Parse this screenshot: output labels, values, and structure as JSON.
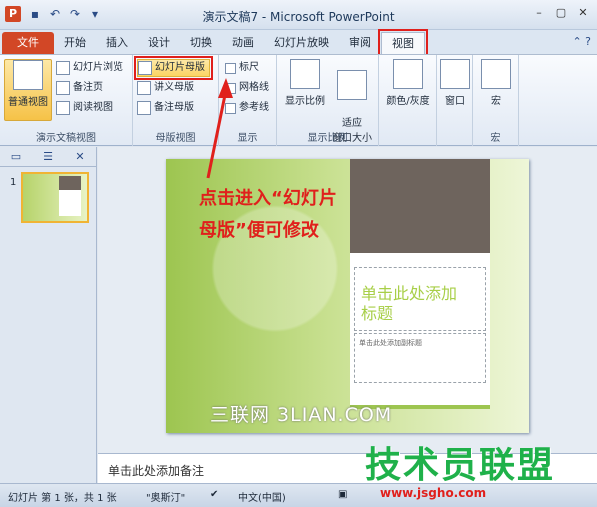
{
  "window": {
    "title": "演示文稿7 - Microsoft PowerPoint",
    "app_icon": "P"
  },
  "quick_access": [
    "save-icon",
    "undo-icon",
    "redo-icon",
    "customize-icon"
  ],
  "window_buttons": [
    "minimize-icon",
    "restore-icon",
    "close-icon"
  ],
  "tabs": [
    {
      "label": "文件"
    },
    {
      "label": "开始"
    },
    {
      "label": "插入"
    },
    {
      "label": "设计"
    },
    {
      "label": "切换"
    },
    {
      "label": "动画"
    },
    {
      "label": "幻灯片放映"
    },
    {
      "label": "审阅"
    },
    {
      "label": "视图"
    }
  ],
  "ribbon": {
    "presentation_views": {
      "label": "演示文稿视图",
      "normal": "普通视图",
      "slide_sorter": "幻灯片浏览",
      "notes_page": "备注页",
      "reading_view": "阅读视图"
    },
    "master_views": {
      "label": "母版视图",
      "slide_master": "幻灯片母版",
      "handout_master": "讲义母版",
      "notes_master": "备注母版"
    },
    "show": {
      "label": "显示",
      "ruler": "标尺",
      "gridlines": "网格线",
      "guides": "参考线"
    },
    "zoom": {
      "label": "显示比例",
      "zoom": "显示比例",
      "fit_window": "适应\n窗口大小"
    },
    "color": {
      "label": "颜色/灰度"
    },
    "window": {
      "label": "窗口"
    },
    "macros": {
      "label": "宏",
      "macro": "宏"
    }
  },
  "thumbnail": {
    "number": "1"
  },
  "slide": {
    "title_placeholder": "单击此处添加标题",
    "subtitle_placeholder": "单击此处添加副标题"
  },
  "annotation": "点击进入“幻灯片母版”便可修改",
  "watermark": "三联网 3LIAN.COM",
  "notes": {
    "placeholder": "单击此处添加备注"
  },
  "status": {
    "slide_info": "幻灯片 第 1 张，共 1 张",
    "theme": "\"奥斯汀\"",
    "language": "中文(中国)"
  },
  "brand": {
    "name": "技术员联盟",
    "url": "www.jsgho.com"
  }
}
